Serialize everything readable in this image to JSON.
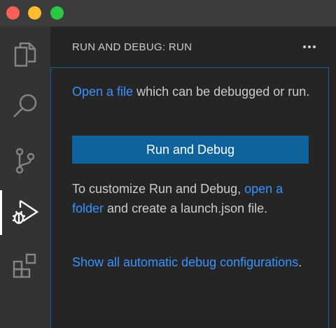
{
  "window": {
    "controls": [
      "close",
      "minimize",
      "zoom"
    ]
  },
  "activity_bar": {
    "items": [
      {
        "name": "explorer",
        "icon": "files-icon"
      },
      {
        "name": "search",
        "icon": "search-icon"
      },
      {
        "name": "source-control",
        "icon": "source-control-icon"
      },
      {
        "name": "run-and-debug",
        "icon": "run-debug-icon",
        "active": true
      },
      {
        "name": "extensions",
        "icon": "extensions-icon"
      }
    ]
  },
  "sidebar": {
    "title": "RUN AND DEBUG: RUN",
    "more_actions_icon": "ellipsis-icon",
    "more_actions_label": "···"
  },
  "welcome": {
    "open_file_link": "Open a file",
    "open_file_suffix": " which can be debugged or run.",
    "run_button_label": "Run and Debug",
    "customize_prefix": "To customize Run and Debug, ",
    "open_folder_link": "open a folder",
    "customize_suffix": " and create a launch.json file.",
    "show_all_link": "Show all automatic debug configurations",
    "show_all_suffix": "."
  },
  "colors": {
    "accent": "#0e639c",
    "link": "#3794ff",
    "text": "#cccccc",
    "activity_bar": "#333333",
    "sidebar": "#252526",
    "titlebar": "#3c3c3c"
  }
}
